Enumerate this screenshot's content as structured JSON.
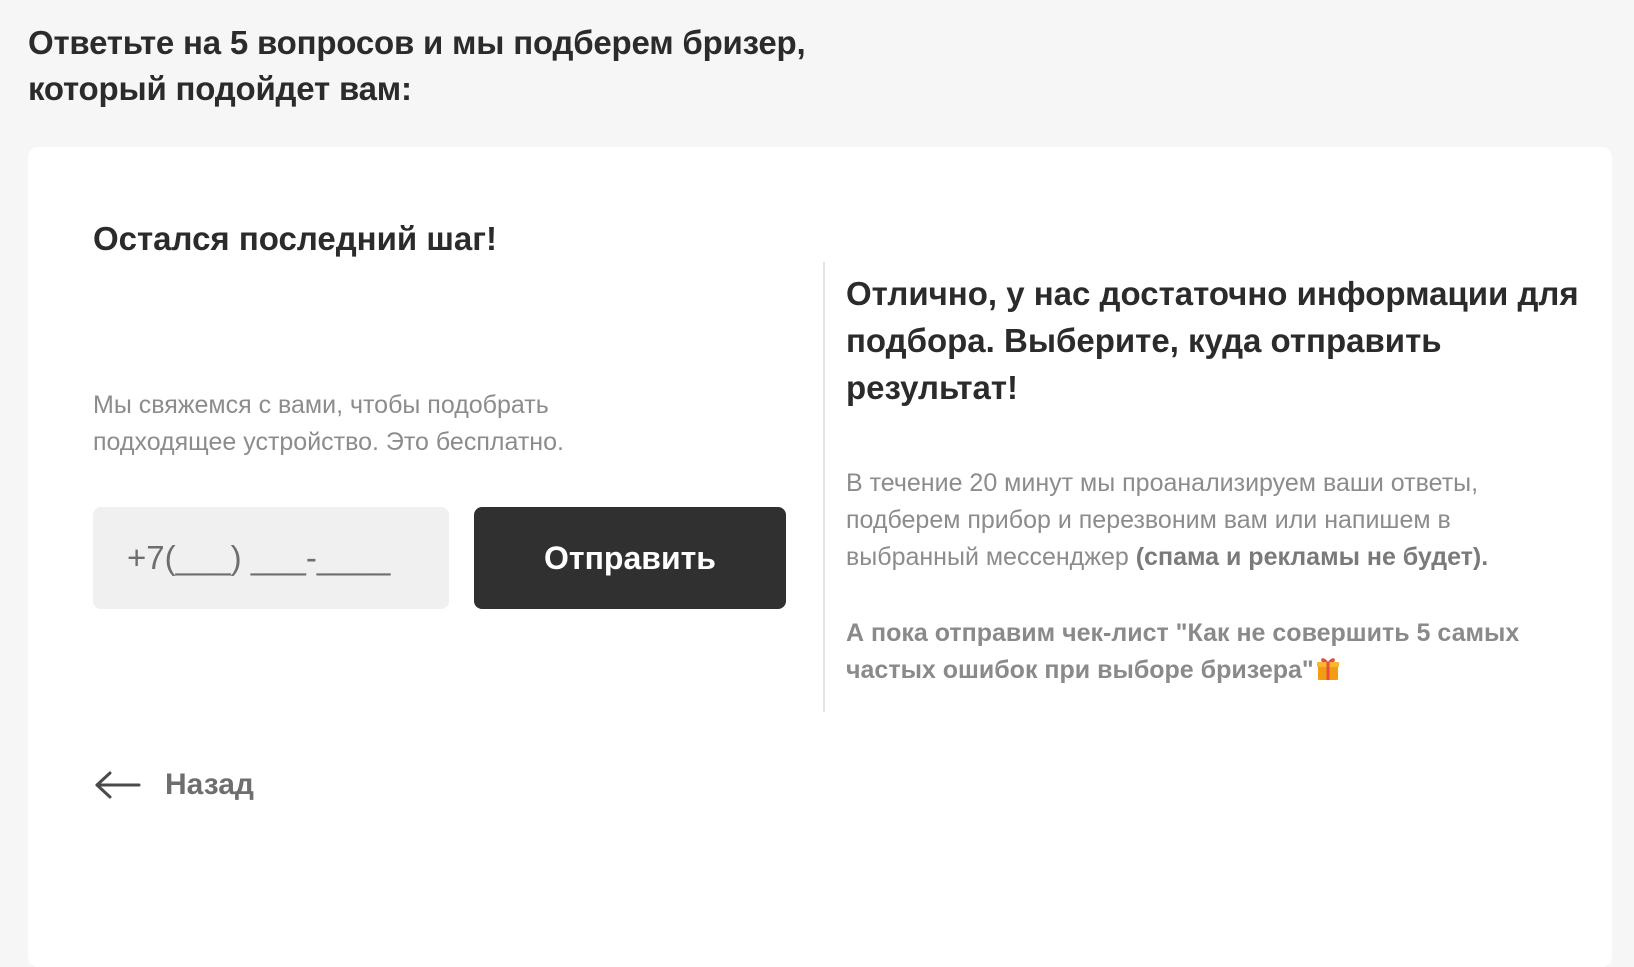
{
  "page": {
    "heading_line1": "Ответьте на 5 вопросов и мы подберем бризер,",
    "heading_line2": "который подойдет вам:"
  },
  "form": {
    "step_title": "Остался последний шаг!",
    "description_line1": "Мы свяжемся с вами, чтобы подобрать",
    "description_line2": "подходящее устройство. Это бесплатно.",
    "phone_placeholder": "+7(___) ___-____",
    "phone_value": "",
    "submit_label": "Отправить",
    "back_label": "Назад",
    "back_icon": "arrow-left-icon"
  },
  "info": {
    "title_line1": "Отлично, у нас достаточно информации для",
    "title_line2": "подбора. Выберите, куда отправить",
    "title_line3": "результат!",
    "text_line1": "В течение 20 минут мы проанализируем ваши ответы,",
    "text_line2": "подберем прибор и перезвоним вам или напишем в",
    "text_line3_start": "выбранный мессенджер ",
    "text_line3_bold": "(спама и рекламы не будет).",
    "bonus_line1": "А пока отправим чек-лист \"Как не совершить 5 самых",
    "bonus_line2": "частых ошибок при выборе бризера\"",
    "bonus_icon": "gift-icon"
  },
  "colors": {
    "page_background": "#f6f6f6",
    "card_background": "#ffffff",
    "button_background": "#303030",
    "input_background": "#f0f0f0",
    "gift_box": "#f39c12",
    "gift_ribbon": "#e74c3c"
  }
}
